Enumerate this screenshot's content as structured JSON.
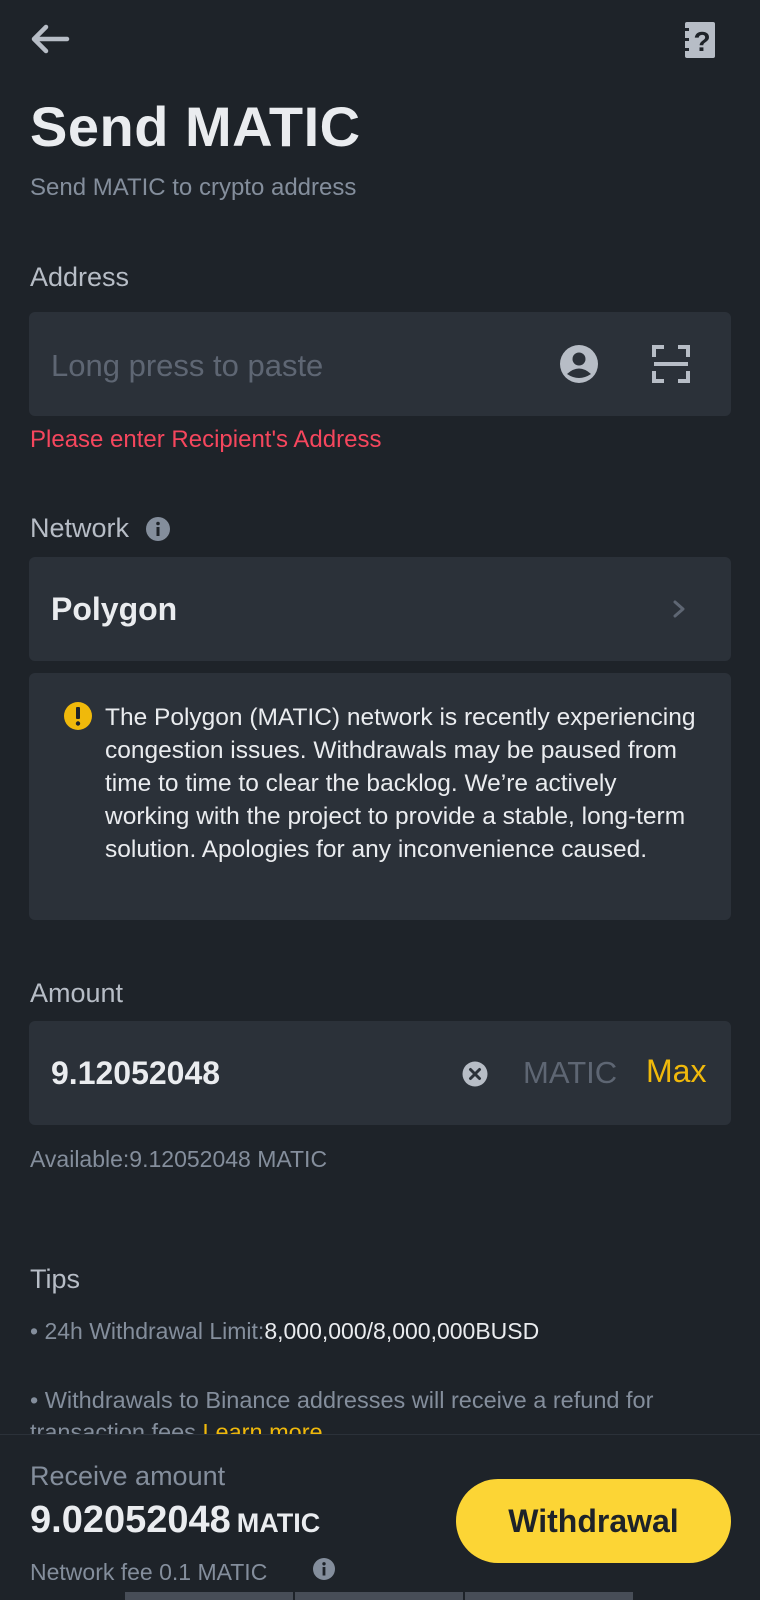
{
  "header": {
    "back_icon": "arrow-left-icon",
    "help_icon": "help-document-icon",
    "title": "Send MATIC",
    "subtitle": "Send MATIC to crypto address"
  },
  "address": {
    "label": "Address",
    "placeholder": "Long press to paste",
    "value": "",
    "contact_icon": "address-book-icon",
    "scan_icon": "qr-scan-icon",
    "error": "Please enter Recipient's Address"
  },
  "network": {
    "label": "Network",
    "info_icon": "info-icon",
    "selected": "Polygon",
    "chevron_icon": "chevron-right-icon",
    "notice_icon": "warning-icon",
    "notice": "The Polygon (MATIC) network is recently experiencing congestion issues. Withdrawals may be paused from time to time to clear the backlog. We’re actively working with the project to provide a stable, long-term solution. Apologies for any inconvenience caused."
  },
  "amount": {
    "label": "Amount",
    "value": "9.12052048",
    "clear_icon": "clear-circle-icon",
    "unit": "MATIC",
    "max_label": "Max",
    "available": "Available:9.12052048 MATIC"
  },
  "tips": {
    "title": "Tips",
    "limit_prefix": "• 24h Withdrawal Limit:",
    "limit_value": "8,000,000/8,000,000BUSD",
    "refund_text": "• Withdrawals to Binance addresses will receive a refund for transaction fees ",
    "learn_more": "Learn more"
  },
  "footer": {
    "receive_label": "Receive amount",
    "receive_value": "9.02052048",
    "receive_unit": "MATIC",
    "fee_text": "Network fee 0.1 MATIC",
    "withdraw_label": "Withdrawal"
  },
  "colors": {
    "background": "#1e2329",
    "field": "#2b3139",
    "accent": "#f0b90b",
    "button": "#fcd535",
    "error": "#f6465d"
  }
}
